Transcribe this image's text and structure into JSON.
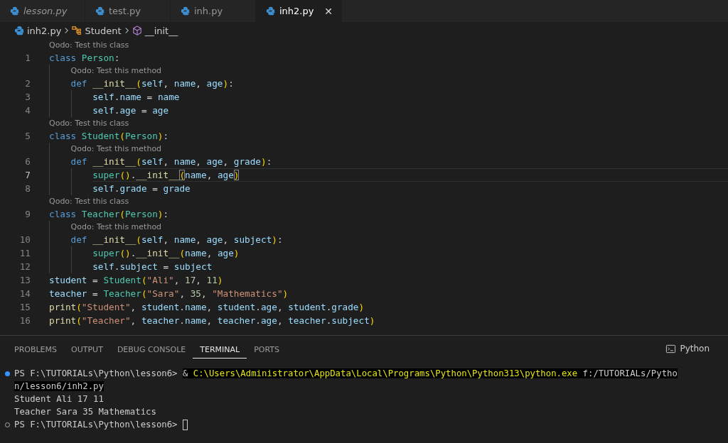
{
  "tabs": [
    {
      "label": "lesson.py",
      "italic": true,
      "selected": false
    },
    {
      "label": "test.py",
      "italic": false,
      "selected": false
    },
    {
      "label": "inh.py",
      "italic": false,
      "selected": false
    },
    {
      "label": "inh2.py",
      "italic": false,
      "selected": true,
      "close": "✕"
    }
  ],
  "breadcrumbs": [
    {
      "kind": "file",
      "label": "inh2.py"
    },
    {
      "kind": "class",
      "label": "Student"
    },
    {
      "kind": "method",
      "label": "__init__"
    }
  ],
  "editor": {
    "lines": [
      {
        "kind": "lens",
        "text": "Qodo: Test this class"
      },
      {
        "kind": "code",
        "number": "1",
        "current": false,
        "tokens": [
          {
            "t": "class ",
            "kind": "kw"
          },
          {
            "t": "Person",
            "kind": "cls"
          },
          {
            "t": ":",
            "kind": "op"
          }
        ],
        "children": [
          {
            "kind": "lens",
            "text": "Qodo: Test this method"
          },
          {
            "kind": "code",
            "number": "2",
            "current": false,
            "tokens": [
              {
                "t": "def ",
                "kind": "kw"
              },
              {
                "t": "__init__",
                "kind": "fn"
              },
              {
                "t": "(",
                "kind": "paren"
              },
              {
                "t": "self",
                "kind": "var"
              },
              {
                "t": ", ",
                "kind": "op"
              },
              {
                "t": "name",
                "kind": "var"
              },
              {
                "t": ", ",
                "kind": "op"
              },
              {
                "t": "age",
                "kind": "var"
              },
              {
                "t": ")",
                "kind": "paren"
              },
              {
                "t": ":",
                "kind": "op"
              }
            ],
            "children": [
              {
                "kind": "code",
                "number": "3",
                "current": false,
                "tokens": [
                  {
                    "t": "self",
                    "kind": "var"
                  },
                  {
                    "t": ".",
                    "kind": "op"
                  },
                  {
                    "t": "name",
                    "kind": "var"
                  },
                  {
                    "t": " = ",
                    "kind": "op"
                  },
                  {
                    "t": "name",
                    "kind": "var"
                  }
                ]
              },
              {
                "kind": "code",
                "number": "4",
                "current": false,
                "tokens": [
                  {
                    "t": "self",
                    "kind": "var"
                  },
                  {
                    "t": ".",
                    "kind": "op"
                  },
                  {
                    "t": "age",
                    "kind": "var"
                  },
                  {
                    "t": " = ",
                    "kind": "op"
                  },
                  {
                    "t": "age",
                    "kind": "var"
                  }
                ]
              }
            ]
          }
        ]
      },
      {
        "kind": "lens",
        "text": "Qodo: Test this class"
      },
      {
        "kind": "code",
        "number": "5",
        "current": false,
        "tokens": [
          {
            "t": "class ",
            "kind": "kw"
          },
          {
            "t": "Student",
            "kind": "cls"
          },
          {
            "t": "(",
            "kind": "paren"
          },
          {
            "t": "Person",
            "kind": "cls"
          },
          {
            "t": ")",
            "kind": "paren"
          },
          {
            "t": ":",
            "kind": "op"
          }
        ],
        "children": [
          {
            "kind": "lens",
            "text": "Qodo: Test this method"
          },
          {
            "kind": "code",
            "number": "6",
            "current": false,
            "tokens": [
              {
                "t": "def ",
                "kind": "kw"
              },
              {
                "t": "__init__",
                "kind": "fn"
              },
              {
                "t": "(",
                "kind": "paren"
              },
              {
                "t": "self",
                "kind": "var"
              },
              {
                "t": ", ",
                "kind": "op"
              },
              {
                "t": "name",
                "kind": "var"
              },
              {
                "t": ", ",
                "kind": "op"
              },
              {
                "t": "age",
                "kind": "var"
              },
              {
                "t": ", ",
                "kind": "op"
              },
              {
                "t": "grade",
                "kind": "var"
              },
              {
                "t": ")",
                "kind": "paren"
              },
              {
                "t": ":",
                "kind": "op"
              }
            ],
            "children": [
              {
                "kind": "code",
                "number": "7",
                "current": true,
                "tokens": [
                  {
                    "t": "super",
                    "kind": "cls"
                  },
                  {
                    "t": "()",
                    "kind": "paren"
                  },
                  {
                    "t": ".",
                    "kind": "op"
                  },
                  {
                    "t": "__init__",
                    "kind": "fn"
                  },
                  {
                    "t": "(",
                    "kind": "match"
                  },
                  {
                    "t": "name",
                    "kind": "var"
                  },
                  {
                    "t": ", ",
                    "kind": "op"
                  },
                  {
                    "t": "age",
                    "kind": "var"
                  },
                  {
                    "t": ")",
                    "kind": "match"
                  }
                ]
              },
              {
                "kind": "code",
                "number": "8",
                "current": false,
                "tokens": [
                  {
                    "t": "self",
                    "kind": "var"
                  },
                  {
                    "t": ".",
                    "kind": "op"
                  },
                  {
                    "t": "grade",
                    "kind": "var"
                  },
                  {
                    "t": " = ",
                    "kind": "op"
                  },
                  {
                    "t": "grade",
                    "kind": "var"
                  }
                ]
              }
            ]
          }
        ]
      },
      {
        "kind": "lens",
        "text": "Qodo: Test this class"
      },
      {
        "kind": "code",
        "number": "9",
        "current": false,
        "tokens": [
          {
            "t": "class ",
            "kind": "kw"
          },
          {
            "t": "Teacher",
            "kind": "cls"
          },
          {
            "t": "(",
            "kind": "paren"
          },
          {
            "t": "Person",
            "kind": "cls"
          },
          {
            "t": ")",
            "kind": "paren"
          },
          {
            "t": ":",
            "kind": "op"
          }
        ],
        "children": [
          {
            "kind": "lens",
            "text": "Qodo: Test this method"
          },
          {
            "kind": "code",
            "number": "10",
            "current": false,
            "tokens": [
              {
                "t": "def ",
                "kind": "kw"
              },
              {
                "t": "__init__",
                "kind": "fn"
              },
              {
                "t": "(",
                "kind": "paren"
              },
              {
                "t": "self",
                "kind": "var"
              },
              {
                "t": ", ",
                "kind": "op"
              },
              {
                "t": "name",
                "kind": "var"
              },
              {
                "t": ", ",
                "kind": "op"
              },
              {
                "t": "age",
                "kind": "var"
              },
              {
                "t": ", ",
                "kind": "op"
              },
              {
                "t": "subject",
                "kind": "var"
              },
              {
                "t": ")",
                "kind": "paren"
              },
              {
                "t": ":",
                "kind": "op"
              }
            ],
            "children": [
              {
                "kind": "code",
                "number": "11",
                "current": false,
                "tokens": [
                  {
                    "t": "super",
                    "kind": "cls"
                  },
                  {
                    "t": "()",
                    "kind": "paren"
                  },
                  {
                    "t": ".",
                    "kind": "op"
                  },
                  {
                    "t": "__init__",
                    "kind": "fn"
                  },
                  {
                    "t": "(",
                    "kind": "paren"
                  },
                  {
                    "t": "name",
                    "kind": "var"
                  },
                  {
                    "t": ", ",
                    "kind": "op"
                  },
                  {
                    "t": "age",
                    "kind": "var"
                  },
                  {
                    "t": ")",
                    "kind": "paren"
                  }
                ]
              },
              {
                "kind": "code",
                "number": "12",
                "current": false,
                "tokens": [
                  {
                    "t": "self",
                    "kind": "var"
                  },
                  {
                    "t": ".",
                    "kind": "op"
                  },
                  {
                    "t": "subject",
                    "kind": "var"
                  },
                  {
                    "t": " = ",
                    "kind": "op"
                  },
                  {
                    "t": "subject",
                    "kind": "var"
                  }
                ]
              }
            ]
          }
        ]
      },
      {
        "kind": "code",
        "number": "13",
        "current": false,
        "tokens": [
          {
            "t": "student",
            "kind": "var"
          },
          {
            "t": " = ",
            "kind": "op"
          },
          {
            "t": "Student",
            "kind": "cls"
          },
          {
            "t": "(",
            "kind": "paren"
          },
          {
            "t": "\"Ali\"",
            "kind": "str"
          },
          {
            "t": ", ",
            "kind": "op"
          },
          {
            "t": "17",
            "kind": "num"
          },
          {
            "t": ", ",
            "kind": "op"
          },
          {
            "t": "11",
            "kind": "num"
          },
          {
            "t": ")",
            "kind": "paren"
          }
        ]
      },
      {
        "kind": "code",
        "number": "14",
        "current": false,
        "tokens": [
          {
            "t": "teacher",
            "kind": "var"
          },
          {
            "t": " = ",
            "kind": "op"
          },
          {
            "t": "Teacher",
            "kind": "cls"
          },
          {
            "t": "(",
            "kind": "paren"
          },
          {
            "t": "\"Sara\"",
            "kind": "str"
          },
          {
            "t": ", ",
            "kind": "op"
          },
          {
            "t": "35",
            "kind": "num"
          },
          {
            "t": ", ",
            "kind": "op"
          },
          {
            "t": "\"Mathematics\"",
            "kind": "str"
          },
          {
            "t": ")",
            "kind": "paren"
          }
        ]
      },
      {
        "kind": "code",
        "number": "15",
        "current": false,
        "tokens": [
          {
            "t": "print",
            "kind": "fn"
          },
          {
            "t": "(",
            "kind": "paren"
          },
          {
            "t": "\"Student\"",
            "kind": "str"
          },
          {
            "t": ", ",
            "kind": "op"
          },
          {
            "t": "student",
            "kind": "var"
          },
          {
            "t": ".",
            "kind": "op"
          },
          {
            "t": "name",
            "kind": "var"
          },
          {
            "t": ", ",
            "kind": "op"
          },
          {
            "t": "student",
            "kind": "var"
          },
          {
            "t": ".",
            "kind": "op"
          },
          {
            "t": "age",
            "kind": "var"
          },
          {
            "t": ", ",
            "kind": "op"
          },
          {
            "t": "student",
            "kind": "var"
          },
          {
            "t": ".",
            "kind": "op"
          },
          {
            "t": "grade",
            "kind": "var"
          },
          {
            "t": ")",
            "kind": "paren"
          }
        ]
      },
      {
        "kind": "code",
        "number": "16",
        "current": false,
        "tokens": [
          {
            "t": "print",
            "kind": "fn"
          },
          {
            "t": "(",
            "kind": "paren"
          },
          {
            "t": "\"Teacher\"",
            "kind": "str"
          },
          {
            "t": ", ",
            "kind": "op"
          },
          {
            "t": "teacher",
            "kind": "var"
          },
          {
            "t": ".",
            "kind": "op"
          },
          {
            "t": "name",
            "kind": "var"
          },
          {
            "t": ", ",
            "kind": "op"
          },
          {
            "t": "teacher",
            "kind": "var"
          },
          {
            "t": ".",
            "kind": "op"
          },
          {
            "t": "age",
            "kind": "var"
          },
          {
            "t": ", ",
            "kind": "op"
          },
          {
            "t": "teacher",
            "kind": "var"
          },
          {
            "t": ".",
            "kind": "op"
          },
          {
            "t": "subject",
            "kind": "var"
          },
          {
            "t": ")",
            "kind": "paren"
          }
        ]
      }
    ]
  },
  "panel": {
    "tabs": [
      {
        "label": "PROBLEMS",
        "selected": false
      },
      {
        "label": "OUTPUT",
        "selected": false
      },
      {
        "label": "DEBUG CONSOLE",
        "selected": false
      },
      {
        "label": "TERMINAL",
        "selected": true
      },
      {
        "label": "PORTS",
        "selected": false
      }
    ],
    "terminal_name": "Python"
  },
  "terminal": {
    "lines": [
      {
        "kind": "command",
        "succeeded": true,
        "prompt": "PS F:\\TUTORIALs\\Python\\lesson6> ",
        "segments": [
          {
            "t": "& ",
            "kind": "plain"
          },
          {
            "t": "C:\\Users\\Administrator\\AppData\\Local\\Programs\\Python\\Python313\\python.exe",
            "kind": "path"
          },
          {
            "t": " f:/TUTORIALs/Pytho",
            "kind": "plain"
          }
        ]
      },
      {
        "kind": "continuation",
        "text": "n/lesson6/inh2.py"
      },
      {
        "kind": "output",
        "text": "Student Ali 17 11"
      },
      {
        "kind": "output",
        "text": "Teacher Sara 35 Mathematics"
      },
      {
        "kind": "prompt",
        "succeeded": false,
        "prompt": "PS F:\\TUTORIALs\\Python\\lesson6> ",
        "cursor": true
      }
    ]
  }
}
